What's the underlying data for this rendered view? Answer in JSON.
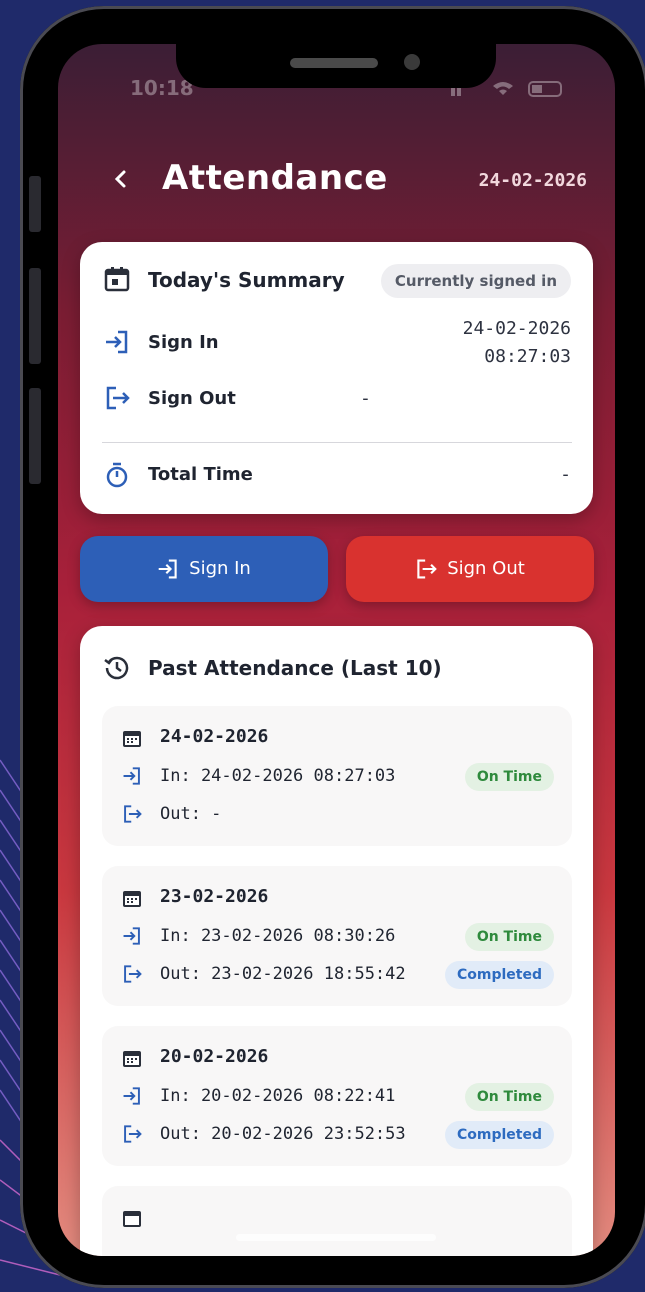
{
  "status_bar": {
    "time": "10:18"
  },
  "header": {
    "title": "Attendance",
    "date": "24-02-2026"
  },
  "summary": {
    "title": "Today's Summary",
    "status_badge": "Currently signed in",
    "sign_in_label": "Sign In",
    "sign_in_date": "24-02-2026",
    "sign_in_time": "08:27:03",
    "sign_out_label": "Sign Out",
    "sign_out_value": "-",
    "total_label": "Total Time",
    "total_value": "-"
  },
  "actions": {
    "sign_in": "Sign In",
    "sign_out": "Sign Out"
  },
  "past": {
    "title": "Past Attendance (Last 10)",
    "entries": [
      {
        "date": "24-02-2026",
        "in": "In: 24-02-2026 08:27:03",
        "out": "Out: -",
        "in_status": "On Time",
        "out_status": ""
      },
      {
        "date": "23-02-2026",
        "in": "In: 23-02-2026 08:30:26",
        "out": "Out: 23-02-2026 18:55:42",
        "in_status": "On Time",
        "out_status": "Completed"
      },
      {
        "date": "20-02-2026",
        "in": "In: 20-02-2026 08:22:41",
        "out": "Out: 20-02-2026 23:52:53",
        "in_status": "On Time",
        "out_status": "Completed"
      }
    ]
  },
  "colors": {
    "sign_in_button": "#2d5fb7",
    "sign_out_button": "#d9322f",
    "status_green": "#2e8a3c",
    "status_blue": "#2d6bc0",
    "icon_blue": "#2d5fb7"
  }
}
